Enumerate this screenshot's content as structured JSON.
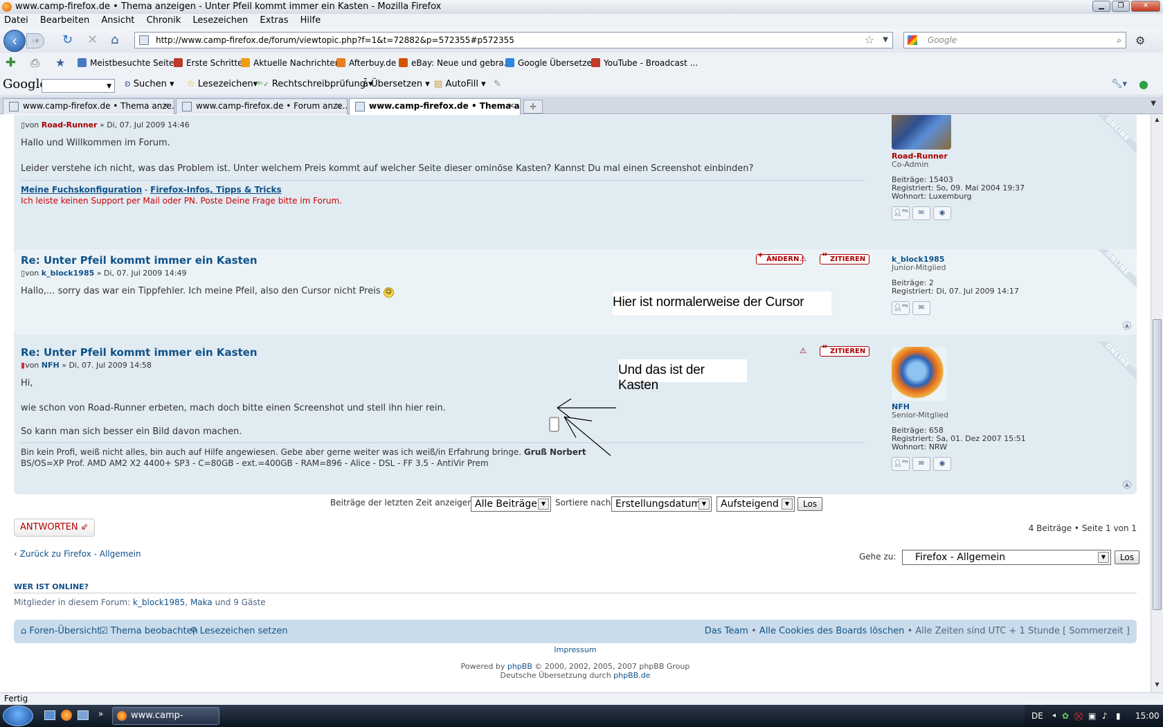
{
  "window": {
    "title": "www.camp-firefox.de • Thema anzeigen - Unter Pfeil kommt immer ein Kasten - Mozilla Firefox"
  },
  "menu": [
    "Datei",
    "Bearbeiten",
    "Ansicht",
    "Chronik",
    "Lesezeichen",
    "Extras",
    "Hilfe"
  ],
  "nav": {
    "url": "http://www.camp-firefox.de/forum/viewtopic.php?f=1&t=72882&p=572355#p572355",
    "search_placeholder": "Google"
  },
  "bookmarks": [
    {
      "label": "Meistbesuchte Seiten",
      "color": "#4a79c2"
    },
    {
      "label": "Erste Schritte",
      "color": "#c0392b"
    },
    {
      "label": "Aktuelle Nachrichten",
      "color": "#f39c12"
    },
    {
      "label": "Afterbuy.de",
      "color": "#e67e22"
    },
    {
      "label": "eBay: Neue und gebra...",
      "color": "#d35400"
    },
    {
      "label": "Google Übersetzer",
      "color": "#2e86de"
    },
    {
      "label": "YouTube - Broadcast ...",
      "color": "#c0392b"
    }
  ],
  "google_toolbar": {
    "logo": "Google",
    "items": [
      "Suchen",
      "Lesezeichen",
      "Rechtschreibprüfung",
      "Übersetzen",
      "AutoFill"
    ]
  },
  "tabs": [
    "www.camp-firefox.de • Thema anze...",
    "www.camp-firefox.de • Forum anze...",
    "www.camp-firefox.de • Thema a..."
  ],
  "posts": [
    {
      "meta_prefix": "von",
      "author": "Road-Runner",
      "date": "» Di, 07. Jul 2009 14:46",
      "lines": [
        "Hallo und Willkommen im Forum.",
        "Leider verstehe ich nicht, was das Problem ist. Unter welchem Preis kommt auf welcher Seite dieser ominöse Kasten? Kannst Du mal einen Screenshot einbinden?"
      ],
      "sig_link1": "Meine Fuchskonfiguration",
      "sig_sep": "-",
      "sig_link2": "Firefox-Infos, Tipps & Tricks",
      "sig_line2": "Ich leiste keinen Support per Mail oder PN. Poste Deine Frage bitte im Forum.",
      "profile": {
        "name": "Road-Runner",
        "rank": "Co-Admin",
        "posts_label": "Beiträge:",
        "posts": "15403",
        "reg_label": "Registriert:",
        "reg": "So, 09. Mai 2004 19:37",
        "loc_label": "Wohnort:",
        "loc": "Luxemburg"
      },
      "online": "ONLINE"
    },
    {
      "title": "Re: Unter Pfeil kommt immer ein Kasten",
      "meta_prefix": "von",
      "author": "k_block1985",
      "date": "» Di, 07. Jul 2009 14:49",
      "text": "Hallo,... sorry das war ein Tippfehler. Ich meine Pfeil, also den Cursor nicht Preis",
      "btn_edit": "ÄNDERN",
      "btn_quote": "ZITIEREN",
      "profile": {
        "name": "k_block1985",
        "rank": "Junior-Mitglied",
        "posts_label": "Beiträge:",
        "posts": "2",
        "reg_label": "Registriert:",
        "reg": "Di, 07. Jul 2009 14:17"
      },
      "online": "ONLINE"
    },
    {
      "title": "Re: Unter Pfeil kommt immer ein Kasten",
      "meta_prefix": "von",
      "author": "NFH",
      "date": "» Di, 07. Jul 2009 14:58",
      "lines": [
        "Hi,",
        "wie schon von Road-Runner erbeten, mach doch bitte einen Screenshot und stell ihn hier rein.",
        "So kann man sich besser ein Bild davon machen."
      ],
      "sig_line1": "Bin kein Profi, weiß nicht alles, bin auch auf Hilfe angewiesen. Gebe aber gerne weiter was ich weiß/in Erfahrung bringe.",
      "sig_bold": "Gruß Norbert",
      "sig_line2": "BS/OS=XP Prof. AMD AM2 X2 4400+ SP3 - C=80GB - ext.=400GB - RAM=896 - Alice - DSL - FF 3.5 - AntiVir Prem",
      "btn_quote": "ZITIEREN",
      "profile": {
        "name": "NFH",
        "rank": "Senior-Mitglied",
        "posts_label": "Beiträge:",
        "posts": "658",
        "reg_label": "Registriert:",
        "reg": "Sa, 01. Dez 2007 15:51",
        "loc_label": "Wohnort:",
        "loc": "NRW"
      },
      "online": "ONLINE"
    }
  ],
  "annotations": {
    "cursor_note": "Hier ist normalerweise der Cursor",
    "box_note": "Und das ist der Kasten"
  },
  "sortbar": {
    "label_show": "Beiträge der letzten Zeit anzeigen:",
    "show_value": "Alle Beiträge",
    "label_sort": "Sortiere nach",
    "sort_value": "Erstellungsdatum",
    "order_value": "Aufsteigend",
    "go": "Los"
  },
  "reply_button": "ANTWORTEN",
  "pagination": "4 Beiträge • Seite 1 von 1",
  "back_link": "Zurück zu Firefox - Allgemein",
  "jump": {
    "label": "Gehe zu:",
    "value": "Firefox - Allgemein",
    "go": "Los"
  },
  "online_section": {
    "heading": "WER IST ONLINE?",
    "prefix": "Mitglieder in diesem Forum:",
    "user1": "k_block1985",
    "sep": ",",
    "user2": "Maka",
    "suffix": "und 9 Gäste"
  },
  "footer": {
    "index": "Foren-Übersicht",
    "watch": "Thema beobachten",
    "bookmark": "Lesezeichen setzen",
    "team": "Das Team",
    "cookies": "Alle Cookies des Boards löschen",
    "timezone": "Alle Zeiten sind UTC + 1 Stunde [ Sommerzeit ]",
    "bullet": "•"
  },
  "impressum": "Impressum",
  "powered": {
    "prefix": "Powered by",
    "link": "phpBB",
    "suffix": "© 2000, 2002, 2005, 2007 phpBB Group",
    "line2_prefix": "Deutsche Übersetzung durch",
    "line2_link": "phpBB.de"
  },
  "status": "Fertig",
  "taskbar": {
    "item": "www.camp-firefox....",
    "lang": "DE",
    "time": "15:00"
  }
}
